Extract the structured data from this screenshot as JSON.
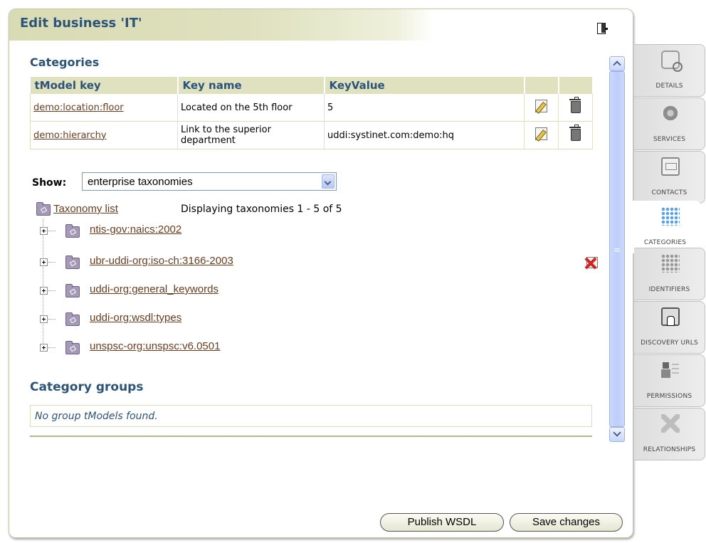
{
  "window": {
    "title": "Edit business 'IT'"
  },
  "categories": {
    "heading": "Categories",
    "columns": [
      "tModel key",
      "Key name",
      "KeyValue"
    ],
    "rows": [
      {
        "tmodel_key": "demo:location:floor",
        "key_name": "Located on the 5th floor",
        "key_value": "5"
      },
      {
        "tmodel_key": "demo:hierarchy",
        "key_name": "Link to the superior department",
        "key_value": "uddi:systinet.com:demo:hq"
      }
    ]
  },
  "show": {
    "label": "Show:",
    "selected": "enterprise taxonomies"
  },
  "taxonomy": {
    "list_link": "Taxonomy list",
    "info": "Displaying taxonomies 1 - 5 of 5",
    "items": [
      "ntis-gov:naics:2002",
      "ubr-uddi-org:iso-ch:3166-2003",
      "uddi-org:general_keywords",
      "uddi-org:wsdl:types",
      "unspsc-org:unspsc:v6.0501"
    ]
  },
  "category_groups": {
    "heading": "Category groups",
    "empty_text": "No group tModels found."
  },
  "buttons": {
    "publish": "Publish WSDL",
    "save": "Save changes"
  },
  "tabs": [
    {
      "label": "DETAILS",
      "icon": "details-icon"
    },
    {
      "label": "SERVICES",
      "icon": "services-icon"
    },
    {
      "label": "CONTACTS",
      "icon": "contacts-icon"
    },
    {
      "label": "CATEGORIES",
      "icon": "categories-icon",
      "active": true
    },
    {
      "label": "IDENTIFIERS",
      "icon": "identifiers-icon"
    },
    {
      "label": "DISCOVERY URLS",
      "icon": "discovery-urls-icon"
    },
    {
      "label": "PERMISSIONS",
      "icon": "permissions-icon"
    },
    {
      "label": "RELATIONSHIPS",
      "icon": "relationships-icon"
    }
  ],
  "colors": {
    "heading": "#2c5378",
    "link": "#6b3d1d",
    "header_bg": "#dfe1bf"
  }
}
